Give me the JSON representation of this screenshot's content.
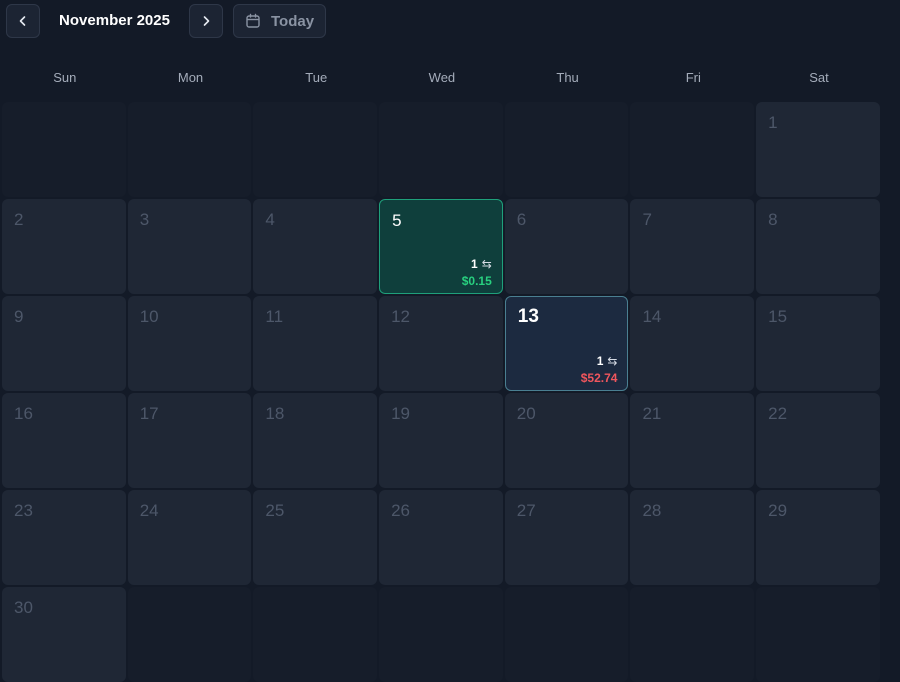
{
  "header": {
    "title": "November 2025",
    "today_label": "Today",
    "prev_icon": "chevron-left-icon",
    "next_icon": "chevron-right-icon",
    "calendar_icon": "calendar-icon"
  },
  "weekdays": [
    "Sun",
    "Mon",
    "Tue",
    "Wed",
    "Thu",
    "Fri",
    "Sat"
  ],
  "colors": {
    "background": "#131a27",
    "cell": "#1f2735",
    "positive": "#28d07f",
    "negative": "#f0565d",
    "tx_cell_border": "#1fa07b",
    "today_border": "#4a7f91"
  },
  "calendar": {
    "leading_empty": 6,
    "days_in_month": 30,
    "today": 13,
    "transactions": {
      "5": {
        "count": "1",
        "amount": "$0.15",
        "sign": "positive"
      },
      "13": {
        "count": "1",
        "amount": "$52.74",
        "sign": "negative"
      }
    }
  },
  "swap_icon": "swap-arrows-icon"
}
